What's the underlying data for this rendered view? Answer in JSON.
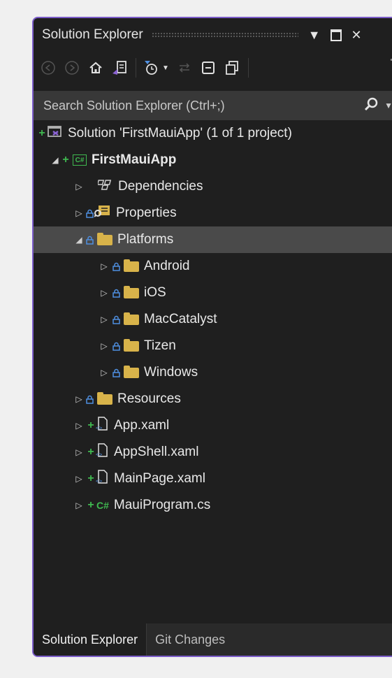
{
  "window": {
    "title": "Solution Explorer"
  },
  "toolbar": {
    "tools": [
      "back-icon",
      "forward-icon",
      "home-icon",
      "switch-views-icon",
      "pending-changes-filter-icon",
      "sync-icon",
      "collapse-all-icon",
      "show-all-files-icon"
    ]
  },
  "search": {
    "placeholder": "Search Solution Explorer (Ctrl+;)"
  },
  "tree": {
    "solution": "Solution 'FirstMauiApp' (1 of 1 project)",
    "project": "FirstMauiApp",
    "dependencies": "Dependencies",
    "properties": "Properties",
    "platforms": "Platforms",
    "android": "Android",
    "ios": "iOS",
    "maccatalyst": "MacCatalyst",
    "tizen": "Tizen",
    "windows": "Windows",
    "resources": "Resources",
    "app_xaml": "App.xaml",
    "appshell_xaml": "AppShell.xaml",
    "mainpage_xaml": "MainPage.xaml",
    "mauiprogram_cs": "MauiProgram.cs",
    "cs_badge": "C#",
    "cs_file_badge": "C#"
  },
  "tabs": {
    "solution_explorer": "Solution Explorer",
    "git_changes": "Git Changes"
  },
  "colors": {
    "accent": "#7b5cc9",
    "git_added": "#3fb950",
    "folder": "#d8b34a",
    "lock": "#4f8fe0"
  }
}
